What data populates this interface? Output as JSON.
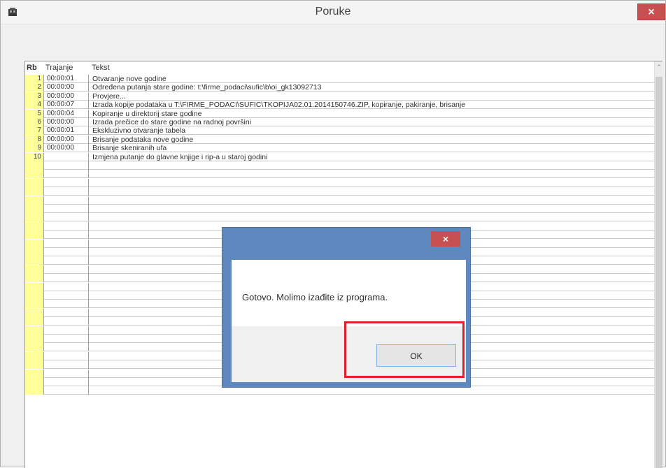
{
  "window": {
    "title": "Poruke",
    "close_label": "×"
  },
  "grid": {
    "columns": [
      "Rb",
      "Trajanje",
      "Tekst"
    ],
    "current_row": 4,
    "rows": [
      {
        "rb": "1",
        "trajanje": "00:00:01",
        "tekst": "Otvaranje nove godine"
      },
      {
        "rb": "2",
        "trajanje": "00:00:00",
        "tekst": "Određena putanja stare godine: t:\\firme_podaci\\sufic\\b\\oi_gk13092713"
      },
      {
        "rb": "3",
        "trajanje": "00:00:00",
        "tekst": "Provjere..."
      },
      {
        "rb": "4",
        "trajanje": "00:00:07",
        "tekst": "Izrada kopije podataka u T:\\FIRME_PODACI\\SUFIC\\TKOPIJA02.01.2014150746.ZIP, kopiranje, pakiranje, brisanje"
      },
      {
        "rb": "5",
        "trajanje": "00:00:04",
        "tekst": "Kopiranje u direktorij stare godine"
      },
      {
        "rb": "6",
        "trajanje": "00:00:00",
        "tekst": "Izrada prečice do stare godine na radnoj površini"
      },
      {
        "rb": "7",
        "trajanje": "00:00:01",
        "tekst": "Ekskluzivno otvaranje tabela"
      },
      {
        "rb": "8",
        "trajanje": "00:00:00",
        "tekst": "Brisanje podataka nove godine"
      },
      {
        "rb": "9",
        "trajanje": "00:00:00",
        "tekst": "Brisanje skeniranih ufa"
      },
      {
        "rb": "10",
        "trajanje": "",
        "tekst": "Izmjena putanje do glavne knjige i rip-a u staroj godini"
      }
    ],
    "empty_rows": 27
  },
  "dialog": {
    "close_label": "×",
    "message": "Gotovo. Molimo izađite iz programa.",
    "ok_label": "OK"
  },
  "colors": {
    "rb_column": "#ffff99",
    "close_button": "#c75050",
    "dialog_frame": "#5f89be",
    "highlight": "#e0202a"
  },
  "icons": {
    "app": "application-icon",
    "scroll_up": "scroll-up-arrow-icon",
    "row_pointer": "current-row-pointer-icon"
  }
}
